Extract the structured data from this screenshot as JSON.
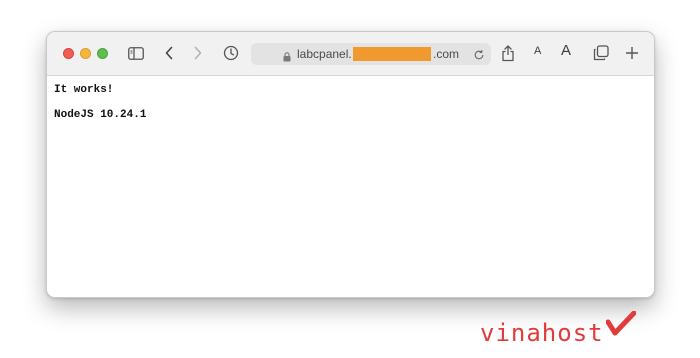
{
  "browser": {
    "url_prefix": "labcpanel.",
    "url_suffix": ".com",
    "font_small_label": "A",
    "font_large_label": "A",
    "icons": [
      "sidebar-icon",
      "back-icon",
      "forward-icon",
      "history-icon",
      "lock-icon",
      "reload-icon",
      "share-icon",
      "tabs-icon",
      "new-tab-icon"
    ]
  },
  "page": {
    "line1": "It works!",
    "line2": "NodeJS 10.24.1"
  },
  "watermark": {
    "text": "vinahost",
    "color": "#e23b3a"
  },
  "colors": {
    "redaction": "#f0992e",
    "close": "#ee5e55",
    "minimize": "#f4b63f",
    "zoom": "#5fbe4f"
  }
}
